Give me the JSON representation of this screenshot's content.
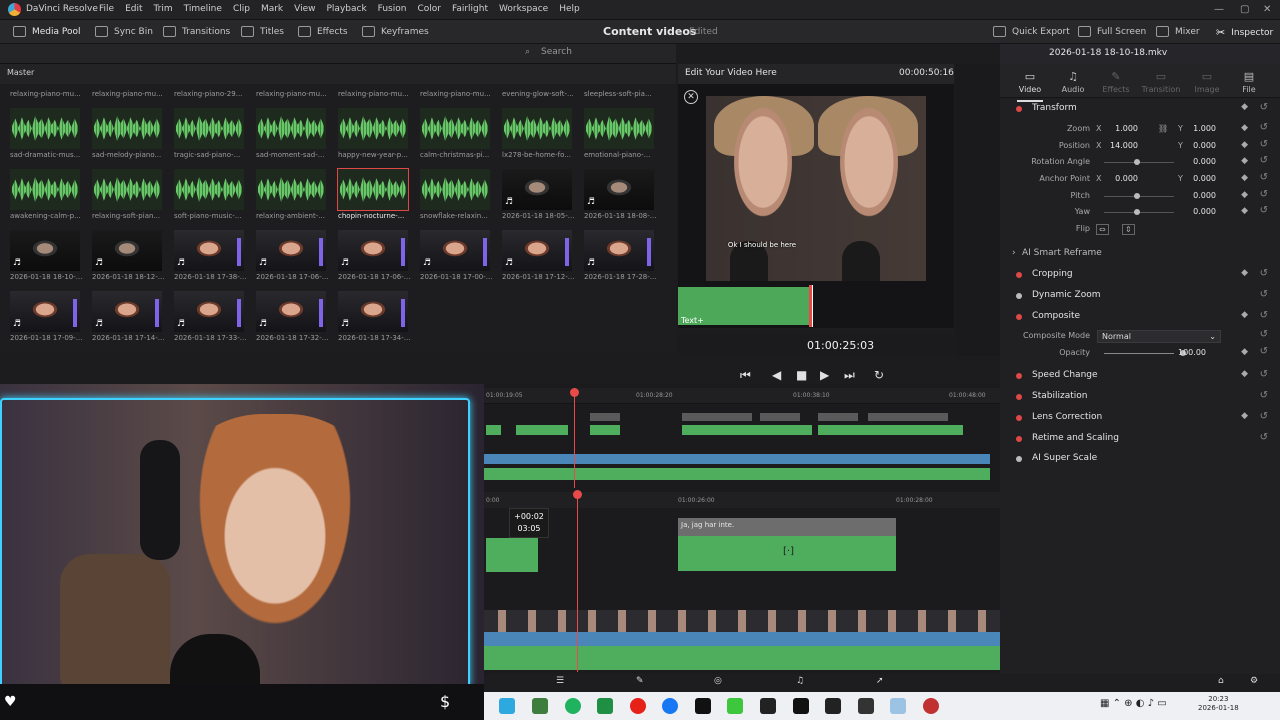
{
  "app": {
    "name": "DaVinci Resolve",
    "menu": [
      "File",
      "Edit",
      "Trim",
      "Timeline",
      "Clip",
      "Mark",
      "View",
      "Playback",
      "Fusion",
      "Color",
      "Fairlight",
      "Workspace",
      "Help"
    ]
  },
  "toolbar": {
    "media_pool": "Media Pool",
    "sync_bin": "Sync Bin",
    "transitions": "Transitions",
    "titles": "Titles",
    "effects": "Effects",
    "keyframes": "Keyframes",
    "project_title": "Content videos",
    "edited": "Edited",
    "quick_export": "Quick Export",
    "full_screen": "Full Screen",
    "mixer": "Mixer",
    "inspector": "Inspector"
  },
  "media": {
    "search_placeholder": "Search",
    "bin": "Master",
    "top_row_labels": [
      "relaxing-piano-mu...",
      "relaxing-piano-mu...",
      "relaxing-piano-29...",
      "relaxing-piano-mu...",
      "relaxing-piano-mu...",
      "relaxing-piano-mu...",
      "evening-glow-soft-...",
      "sleepless-soft-pia..."
    ],
    "clips": [
      {
        "label": "sad-dramatic-mus...",
        "kind": "audio"
      },
      {
        "label": "sad-melody-piano...",
        "kind": "audio"
      },
      {
        "label": "tragic-sad-piano-...",
        "kind": "audio"
      },
      {
        "label": "sad-moment-sad-...",
        "kind": "audio"
      },
      {
        "label": "happy-new-year-p...",
        "kind": "audio"
      },
      {
        "label": "calm-christmas-pi...",
        "kind": "audio"
      },
      {
        "label": "lx278-be-home-fo...",
        "kind": "audio"
      },
      {
        "label": "emotional-piano-...",
        "kind": "audio"
      },
      {
        "label": "awakening-calm-p...",
        "kind": "audio"
      },
      {
        "label": "relaxing-soft-pian...",
        "kind": "audio"
      },
      {
        "label": "soft-piano-music-...",
        "kind": "audio"
      },
      {
        "label": "relaxing-ambient-...",
        "kind": "audio"
      },
      {
        "label": "chopin-nocturne-...",
        "kind": "audio",
        "selected": true
      },
      {
        "label": "snowflake-relaxin...",
        "kind": "audio"
      },
      {
        "label": "2026-01-18 18-05-...",
        "kind": "dark"
      },
      {
        "label": "2026-01-18 18-08-...",
        "kind": "dark"
      },
      {
        "label": "2026-01-18 18-10-...",
        "kind": "dark"
      },
      {
        "label": "2026-01-18 18-12-...",
        "kind": "dark"
      },
      {
        "label": "2026-01-18 17-38-...",
        "kind": "video"
      },
      {
        "label": "2026-01-18 17-06-...",
        "kind": "video"
      },
      {
        "label": "2026-01-18 17-06-...",
        "kind": "video"
      },
      {
        "label": "2026-01-18 17-00-...",
        "kind": "video"
      },
      {
        "label": "2026-01-18 17-12-...",
        "kind": "video"
      },
      {
        "label": "2026-01-18 17-28-...",
        "kind": "video"
      },
      {
        "label": "2026-01-18 17-09-...",
        "kind": "video"
      },
      {
        "label": "2026-01-18 17-14-...",
        "kind": "video"
      },
      {
        "label": "2026-01-18 17-33-...",
        "kind": "video"
      },
      {
        "label": "2026-01-18 17-32-...",
        "kind": "video"
      },
      {
        "label": "2026-01-18 17-34-...",
        "kind": "video"
      }
    ]
  },
  "viewer": {
    "title": "Edit Your Video Here",
    "duration": "00:00:50:16",
    "subtitle": "Ok I should be here",
    "mini_clip_label": "Text+",
    "timecode": "01:00:25:03"
  },
  "inspector": {
    "file": "2026-01-18 18-10-18.mkv",
    "tabs": [
      "Video",
      "Audio",
      "Effects",
      "Transition",
      "Image",
      "File"
    ],
    "transform": "Transform",
    "zoom_label": "Zoom",
    "zoom_x": "1.000",
    "zoom_y": "1.000",
    "position_label": "Position",
    "position_x": "14.000",
    "position_y": "0.000",
    "rotation_label": "Rotation Angle",
    "rotation": "0.000",
    "anchor_label": "Anchor Point",
    "anchor_x": "0.000",
    "anchor_y": "0.000",
    "pitch_label": "Pitch",
    "pitch": "0.000",
    "yaw_label": "Yaw",
    "yaw": "0.000",
    "flip_label": "Flip",
    "smart_reframe": "AI Smart Reframe",
    "cropping": "Cropping",
    "dynamic_zoom": "Dynamic Zoom",
    "composite": "Composite",
    "composite_mode_label": "Composite Mode",
    "composite_mode": "Normal",
    "opacity_label": "Opacity",
    "opacity": "100.00",
    "speed_change": "Speed Change",
    "stabilization": "Stabilization",
    "lens_correction": "Lens Correction",
    "retime": "Retime and Scaling",
    "super_scale": "AI Super Scale"
  },
  "timeline": {
    "ruler1": [
      "01:00:19:05",
      "01:00:28:20",
      "01:00:38:10",
      "01:00:48:00"
    ],
    "ruler2": [
      "0:00",
      "01:00:26:00",
      "01:00:28:00"
    ],
    "tooltip_offset": "+00:02",
    "tooltip_time": "03:05",
    "text_clip": "Ja, jag har inte."
  },
  "taskbar": {
    "time": "20:23",
    "date": "2026-01-18"
  }
}
